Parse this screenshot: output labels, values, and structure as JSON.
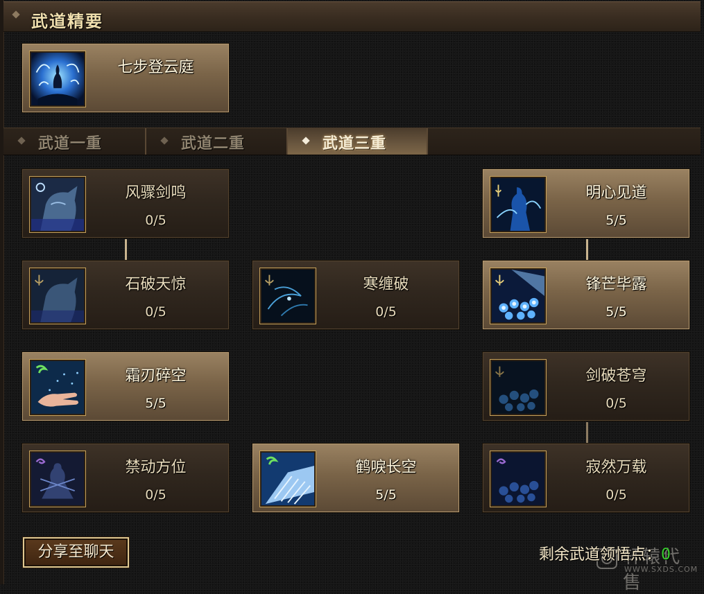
{
  "header": {
    "title": "武道精要"
  },
  "featured": {
    "name": "七步登云庭",
    "icon": "wave-spirit-icon"
  },
  "tabs": [
    {
      "label": "武道一重",
      "active": false
    },
    {
      "label": "武道二重",
      "active": false
    },
    {
      "label": "武道三重",
      "active": true
    }
  ],
  "skills": [
    {
      "name": "风骤剑鸣",
      "level": "0/5",
      "icon": "wolf-moon-icon"
    },
    {
      "name": "明心见道",
      "level": "5/5",
      "icon": "enlightened-figure-icon"
    },
    {
      "name": "石破天惊",
      "level": "0/5",
      "icon": "wolf-anchor-icon"
    },
    {
      "name": "寒缠破",
      "level": "0/5",
      "icon": "ice-swirl-icon"
    },
    {
      "name": "锋芒毕露",
      "level": "5/5",
      "icon": "blue-orbs-icon"
    },
    {
      "name": "霜刃碎空",
      "level": "5/5",
      "icon": "frost-hand-icon"
    },
    {
      "name": "剑破苍穹",
      "level": "0/5",
      "icon": "dim-orbs-icon"
    },
    {
      "name": "禁动方位",
      "level": "0/5",
      "icon": "bound-figure-icon"
    },
    {
      "name": "鹤唳长空",
      "level": "5/5",
      "icon": "crane-wing-icon"
    },
    {
      "name": "寂然万载",
      "level": "0/5",
      "icon": "purple-orbs-icon"
    }
  ],
  "footer": {
    "share_label": "分享至聊天",
    "points_label": "剩余武道领悟点：",
    "points_value": "0"
  },
  "watermark": {
    "text": "轩辕代售",
    "url": "WWW.SXDS.COM"
  },
  "colors": {
    "points_value": "#39d02e",
    "accent_gold": "#c8a25a"
  }
}
